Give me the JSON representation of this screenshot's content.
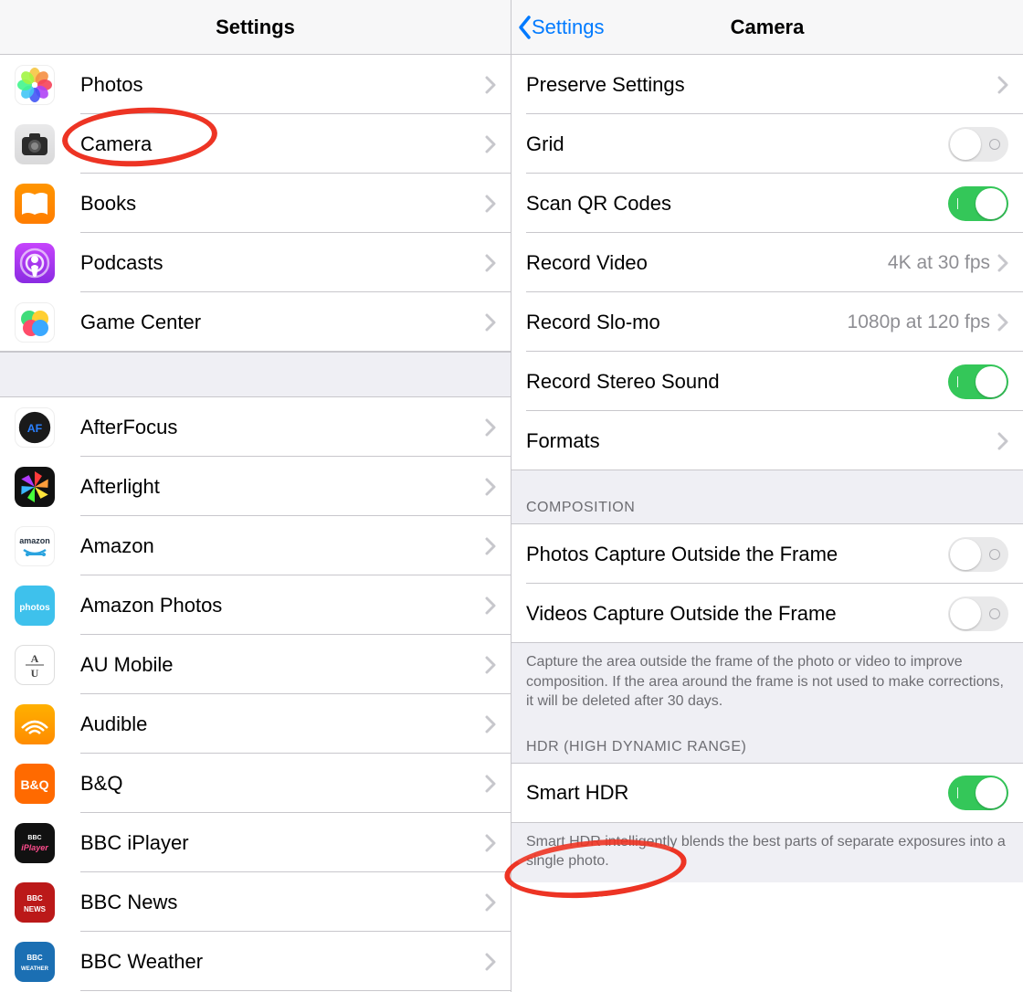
{
  "left": {
    "title": "Settings",
    "group1": [
      {
        "label": "Photos",
        "icon": "photos"
      },
      {
        "label": "Camera",
        "icon": "camera"
      },
      {
        "label": "Books",
        "icon": "books"
      },
      {
        "label": "Podcasts",
        "icon": "podcasts"
      },
      {
        "label": "Game Center",
        "icon": "gamecenter"
      }
    ],
    "group2": [
      {
        "label": "AfterFocus",
        "icon": "afterfocus"
      },
      {
        "label": "Afterlight",
        "icon": "afterlight"
      },
      {
        "label": "Amazon",
        "icon": "amazon"
      },
      {
        "label": "Amazon Photos",
        "icon": "amazonphotos"
      },
      {
        "label": "AU Mobile",
        "icon": "aumobile"
      },
      {
        "label": "Audible",
        "icon": "audible"
      },
      {
        "label": "B&Q",
        "icon": "bq"
      },
      {
        "label": "BBC iPlayer",
        "icon": "bbciplayer"
      },
      {
        "label": "BBC News",
        "icon": "bbcnews"
      },
      {
        "label": "BBC Weather",
        "icon": "bbcweather"
      }
    ]
  },
  "right": {
    "back_label": "Settings",
    "title": "Camera",
    "rows": {
      "preserve": "Preserve Settings",
      "grid": "Grid",
      "scanqr": "Scan QR Codes",
      "record_video": "Record Video",
      "record_video_detail": "4K at 30 fps",
      "record_slomo": "Record Slo-mo",
      "record_slomo_detail": "1080p at 120 fps",
      "stereo": "Record Stereo Sound",
      "formats": "Formats"
    },
    "composition": {
      "header": "COMPOSITION",
      "photos_outside": "Photos Capture Outside the Frame",
      "videos_outside": "Videos Capture Outside the Frame",
      "footer": "Capture the area outside the frame of the photo or video to improve composition. If the area around the frame is not used to make corrections, it will be deleted after 30 days."
    },
    "hdr": {
      "header": "HDR (HIGH DYNAMIC RANGE)",
      "smart_hdr": "Smart HDR",
      "footer": "Smart HDR intelligently blends the best parts of separate exposures into a single photo."
    },
    "toggles": {
      "grid": false,
      "scanqr": true,
      "stereo": true,
      "photos_outside": false,
      "videos_outside": false,
      "smart_hdr": true
    }
  },
  "icon_text": {
    "amazon": "amazon",
    "amazonphotos": "photos",
    "aumobile": "A—U",
    "bq": "B&Q",
    "bbciplayer": "BBC iPlayer",
    "bbcnews": "BBC NEWS",
    "bbcweather": "BBC WEATHER",
    "afterfocus": "AF"
  }
}
